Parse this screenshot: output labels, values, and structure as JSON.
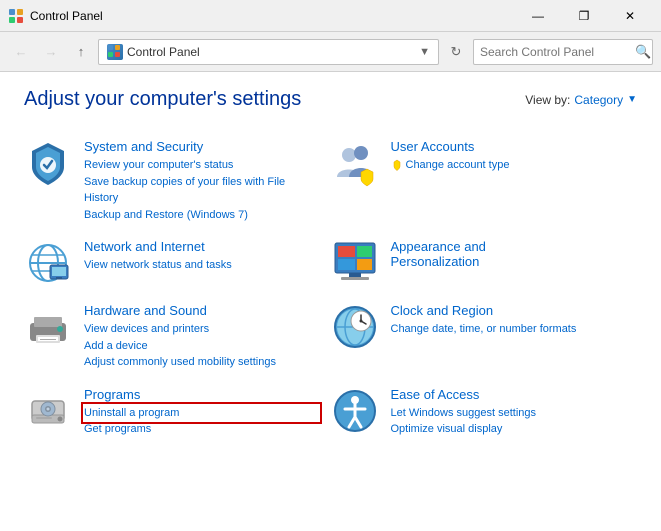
{
  "titleBar": {
    "title": "Control Panel",
    "minBtn": "—",
    "maxBtn": "❐",
    "closeBtn": "✕"
  },
  "addressBar": {
    "pathText": "Control Panel",
    "searchPlaceholder": "Search Control Panel",
    "refreshSymbol": "↻"
  },
  "pageHeader": {
    "title": "Adjust your computer's settings",
    "viewByLabel": "View by:",
    "viewByValue": "Category"
  },
  "categories": [
    {
      "id": "system-security",
      "title": "System and Security",
      "links": [
        "Review your computer's status",
        "Save backup copies of your files with File History",
        "Backup and Restore (Windows 7)"
      ]
    },
    {
      "id": "user-accounts",
      "title": "User Accounts",
      "links": [
        "Change account type"
      ]
    },
    {
      "id": "network-internet",
      "title": "Network and Internet",
      "links": [
        "View network status and tasks"
      ]
    },
    {
      "id": "appearance",
      "title": "Appearance and Personalization",
      "links": []
    },
    {
      "id": "hardware-sound",
      "title": "Hardware and Sound",
      "links": [
        "View devices and printers",
        "Add a device",
        "Adjust commonly used mobility settings"
      ]
    },
    {
      "id": "clock-region",
      "title": "Clock and Region",
      "links": [
        "Change date, time, or number formats"
      ]
    },
    {
      "id": "programs",
      "title": "Programs",
      "links": [
        "Uninstall a program",
        "Get programs"
      ]
    },
    {
      "id": "ease-access",
      "title": "Ease of Access",
      "links": [
        "Let Windows suggest settings",
        "Optimize visual display"
      ]
    }
  ]
}
